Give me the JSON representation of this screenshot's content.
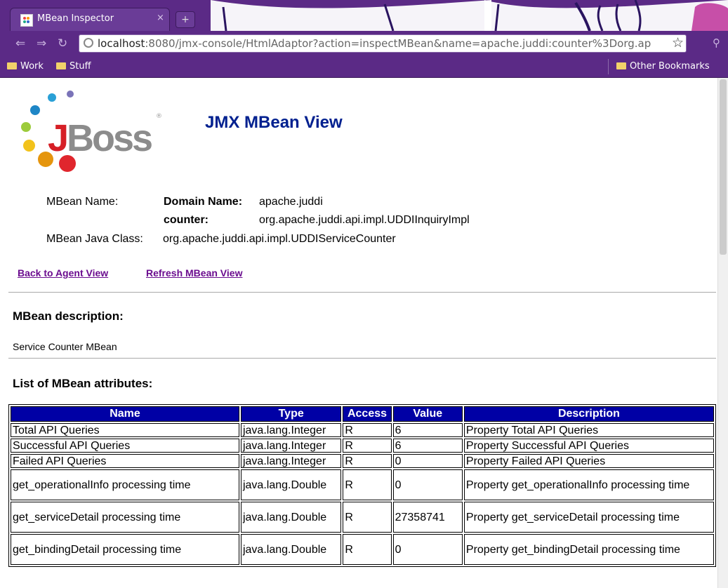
{
  "browser": {
    "tab_title": "MBean Inspector",
    "tab_close": "×",
    "new_tab": "+",
    "url_host": "localhost",
    "url_rest": ":8080/jmx-console/HtmlAdaptor?action=inspectMBean&name=apache.juddi:counter%3Dorg.ap",
    "bookmarks": [
      "Work",
      "Stuff"
    ],
    "other_bookmarks": "Other Bookmarks",
    "theme_colors": {
      "chrome": "#5b2a86"
    }
  },
  "page": {
    "logo_j": "J",
    "logo_oss": "Boss",
    "logo_reg": "®",
    "title": "JMX MBean View",
    "mbean_name_label": "MBean Name:",
    "domain_name_label": "Domain Name:",
    "domain_name_value": "apache.juddi",
    "counter_label": "counter:",
    "counter_value": "org.apache.juddi.api.impl.UDDIInquiryImpl",
    "java_class_label": "MBean Java Class:",
    "java_class_value": "org.apache.juddi.api.impl.UDDIServiceCounter",
    "back_link": "Back to Agent View",
    "refresh_link": "Refresh MBean View",
    "description_heading": "MBean description:",
    "description_text": "Service Counter MBean",
    "attributes_heading": "List of MBean attributes:"
  },
  "table": {
    "headers": [
      "Name",
      "Type",
      "Access",
      "Value",
      "Description"
    ],
    "header_color": "#0000a5",
    "rows": [
      {
        "name": "Total API Queries",
        "type": "java.lang.Integer",
        "access": "R",
        "value": "6",
        "description": "Property Total API Queries"
      },
      {
        "name": "Successful API Queries",
        "type": "java.lang.Integer",
        "access": "R",
        "value": "6",
        "description": "Property Successful API Queries"
      },
      {
        "name": "Failed API Queries",
        "type": "java.lang.Integer",
        "access": "R",
        "value": "0",
        "description": "Property Failed API Queries"
      },
      {
        "name": "get_operationalInfo processing time",
        "type": "java.lang.Double",
        "access": "R",
        "value": "0",
        "description": "Property get_operationalInfo processing time"
      },
      {
        "name": "get_serviceDetail processing time",
        "type": "java.lang.Double",
        "access": "R",
        "value": "27358741",
        "description": "Property get_serviceDetail processing time"
      },
      {
        "name": "get_bindingDetail processing time",
        "type": "java.lang.Double",
        "access": "R",
        "value": "0",
        "description": "Property get_bindingDetail processing time"
      }
    ]
  }
}
